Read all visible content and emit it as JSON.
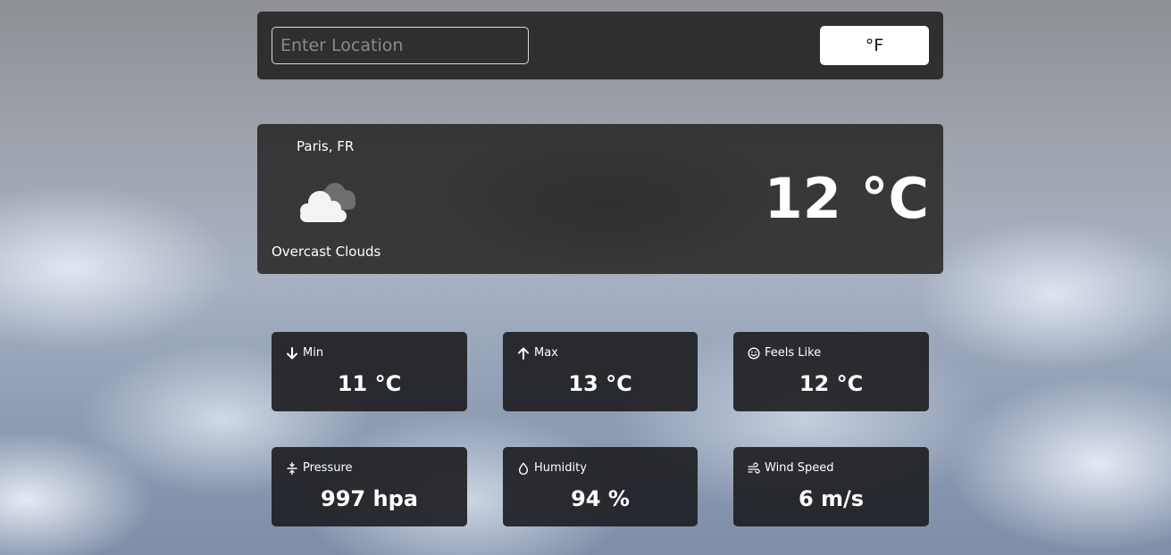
{
  "search": {
    "placeholder": "Enter Location",
    "value": ""
  },
  "unit_toggle": {
    "label": "°F"
  },
  "current": {
    "city": "Paris, FR",
    "description": "Overcast Clouds",
    "temperature": "12 °C",
    "icon": "overcast-clouds-icon"
  },
  "stats": {
    "min": {
      "label": "Min",
      "value": "11 °C",
      "icon": "arrow-down-icon"
    },
    "max": {
      "label": "Max",
      "value": "13 °C",
      "icon": "arrow-up-icon"
    },
    "feels_like": {
      "label": "Feels Like",
      "value": "12 °C",
      "icon": "smile-icon"
    },
    "pressure": {
      "label": "Pressure",
      "value": "997 hpa",
      "icon": "compress-icon"
    },
    "humidity": {
      "label": "Humidity",
      "value": "94 %",
      "icon": "droplet-icon"
    },
    "wind_speed": {
      "label": "Wind Speed",
      "value": "6 m/s",
      "icon": "wind-icon"
    }
  },
  "colors": {
    "panel": "#302f2f",
    "stat_panel": "#1e1f24",
    "text": "#ffffff",
    "button_bg": "#ffffff"
  }
}
